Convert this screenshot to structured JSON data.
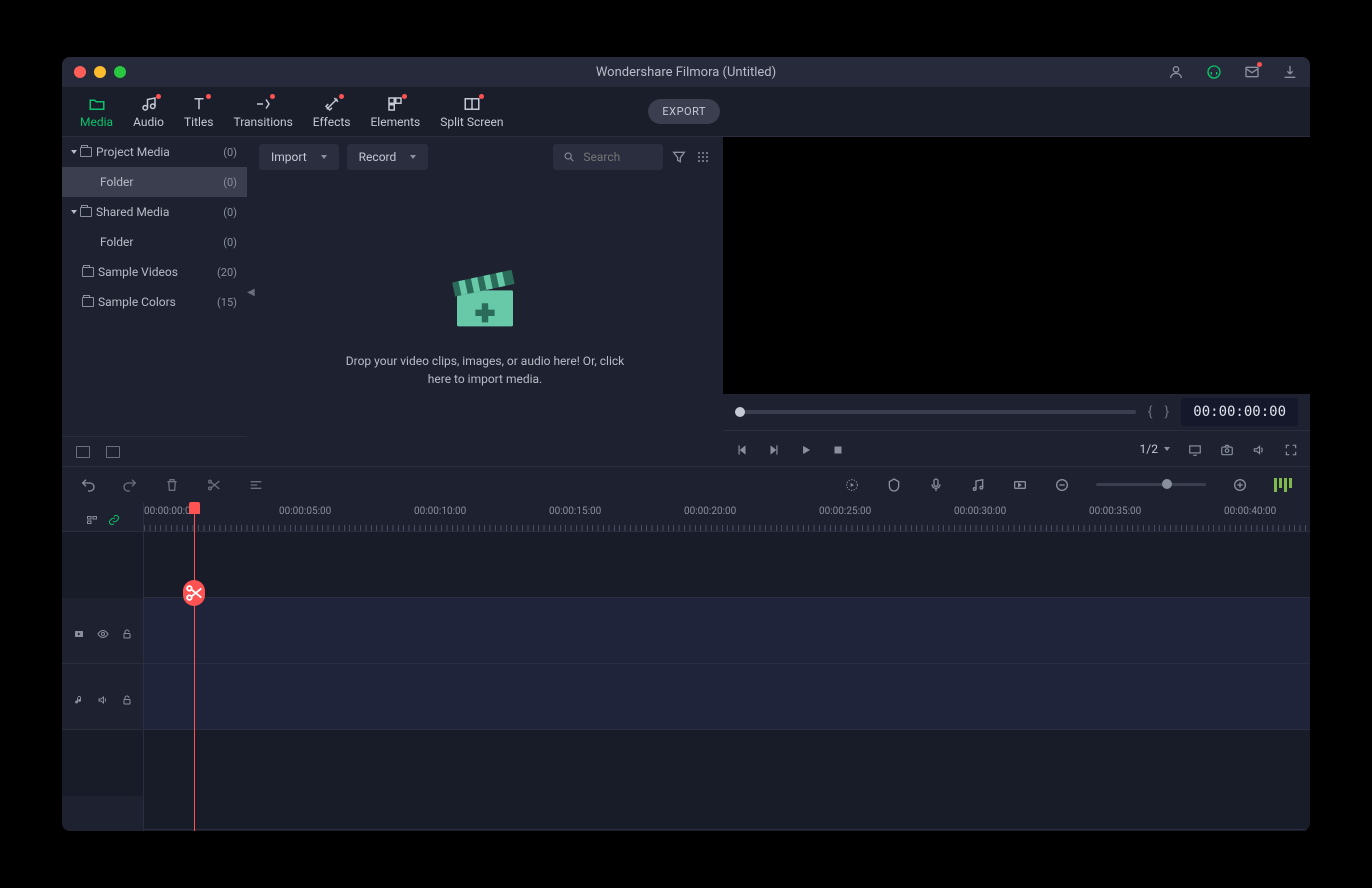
{
  "title": "Wondershare Filmora (Untitled)",
  "tabs": [
    {
      "label": "Media",
      "active": true,
      "dot": false
    },
    {
      "label": "Audio",
      "active": false,
      "dot": true
    },
    {
      "label": "Titles",
      "active": false,
      "dot": true
    },
    {
      "label": "Transitions",
      "active": false,
      "dot": true
    },
    {
      "label": "Effects",
      "active": false,
      "dot": true
    },
    {
      "label": "Elements",
      "active": false,
      "dot": true
    },
    {
      "label": "Split Screen",
      "active": false,
      "dot": true
    }
  ],
  "export_label": "EXPORT",
  "sidebar": {
    "items": [
      {
        "label": "Project Media",
        "count": "(0)",
        "caret": true,
        "folder": true,
        "indent": 0
      },
      {
        "label": "Folder",
        "count": "(0)",
        "caret": false,
        "folder": false,
        "indent": 1,
        "selected": true
      },
      {
        "label": "Shared Media",
        "count": "(0)",
        "caret": true,
        "folder": true,
        "indent": 0
      },
      {
        "label": "Folder",
        "count": "(0)",
        "caret": false,
        "folder": false,
        "indent": 1
      },
      {
        "label": "Sample Videos",
        "count": "(20)",
        "caret": false,
        "folder": true,
        "indent": 0
      },
      {
        "label": "Sample Colors",
        "count": "(15)",
        "caret": false,
        "folder": true,
        "indent": 0
      }
    ]
  },
  "media_toolbar": {
    "import_label": "Import",
    "record_label": "Record",
    "search_placeholder": "Search"
  },
  "drop_text": "Drop your video clips, images, or audio here! Or, click here to import media.",
  "preview": {
    "timecode": "00:00:00:00",
    "ratio": "1/2"
  },
  "ruler_ticks": [
    "00:00:00:00",
    "00:00:05:00",
    "00:00:10:00",
    "00:00:15:00",
    "00:00:20:00",
    "00:00:25:00",
    "00:00:30:00",
    "00:00:35:00",
    "00:00:40:00"
  ]
}
